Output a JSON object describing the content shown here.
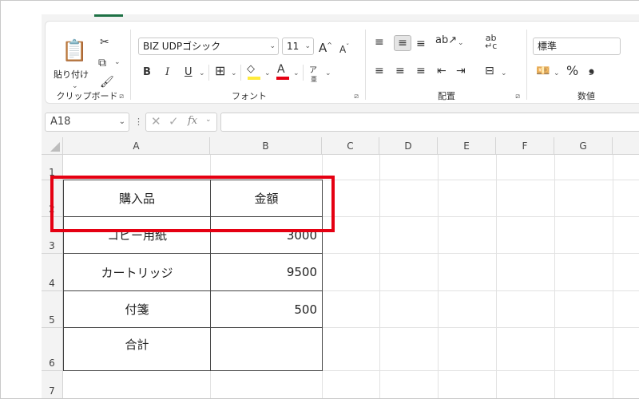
{
  "ribbon": {
    "clipboard": {
      "paste_label": "貼り付け",
      "group_label": "クリップボード"
    },
    "font": {
      "font_name": "BIZ UDPゴシック",
      "font_size": "11",
      "group_label": "フォント",
      "bold": "B",
      "italic": "I",
      "underline": "U",
      "grow": "A",
      "shrink": "A",
      "phonetic": "ア",
      "phonetic_sub": "亜",
      "fill_color": "#ffeb3b",
      "font_color": "#e50012"
    },
    "alignment": {
      "group_label": "配置"
    },
    "number": {
      "format": "標準",
      "group_label": "数値",
      "percent": "%",
      "comma": "❟"
    }
  },
  "formula_bar": {
    "name_box": "A18",
    "fx": "fx",
    "value": ""
  },
  "sheet": {
    "columns": [
      "A",
      "B",
      "C",
      "D",
      "E",
      "F",
      "G"
    ],
    "rows": [
      "1",
      "2",
      "3",
      "4",
      "5",
      "6",
      "7"
    ],
    "table": {
      "header_item": "購入品",
      "header_amount": "金額",
      "items": [
        {
          "name": "コピー用紙",
          "amount": "3000"
        },
        {
          "name": "カートリッジ",
          "amount": "9500"
        },
        {
          "name": "付箋",
          "amount": "500"
        }
      ],
      "total_label": "合計",
      "total_value": ""
    }
  },
  "colors": {
    "highlight": "#e50012",
    "accent": "#1e7145"
  }
}
